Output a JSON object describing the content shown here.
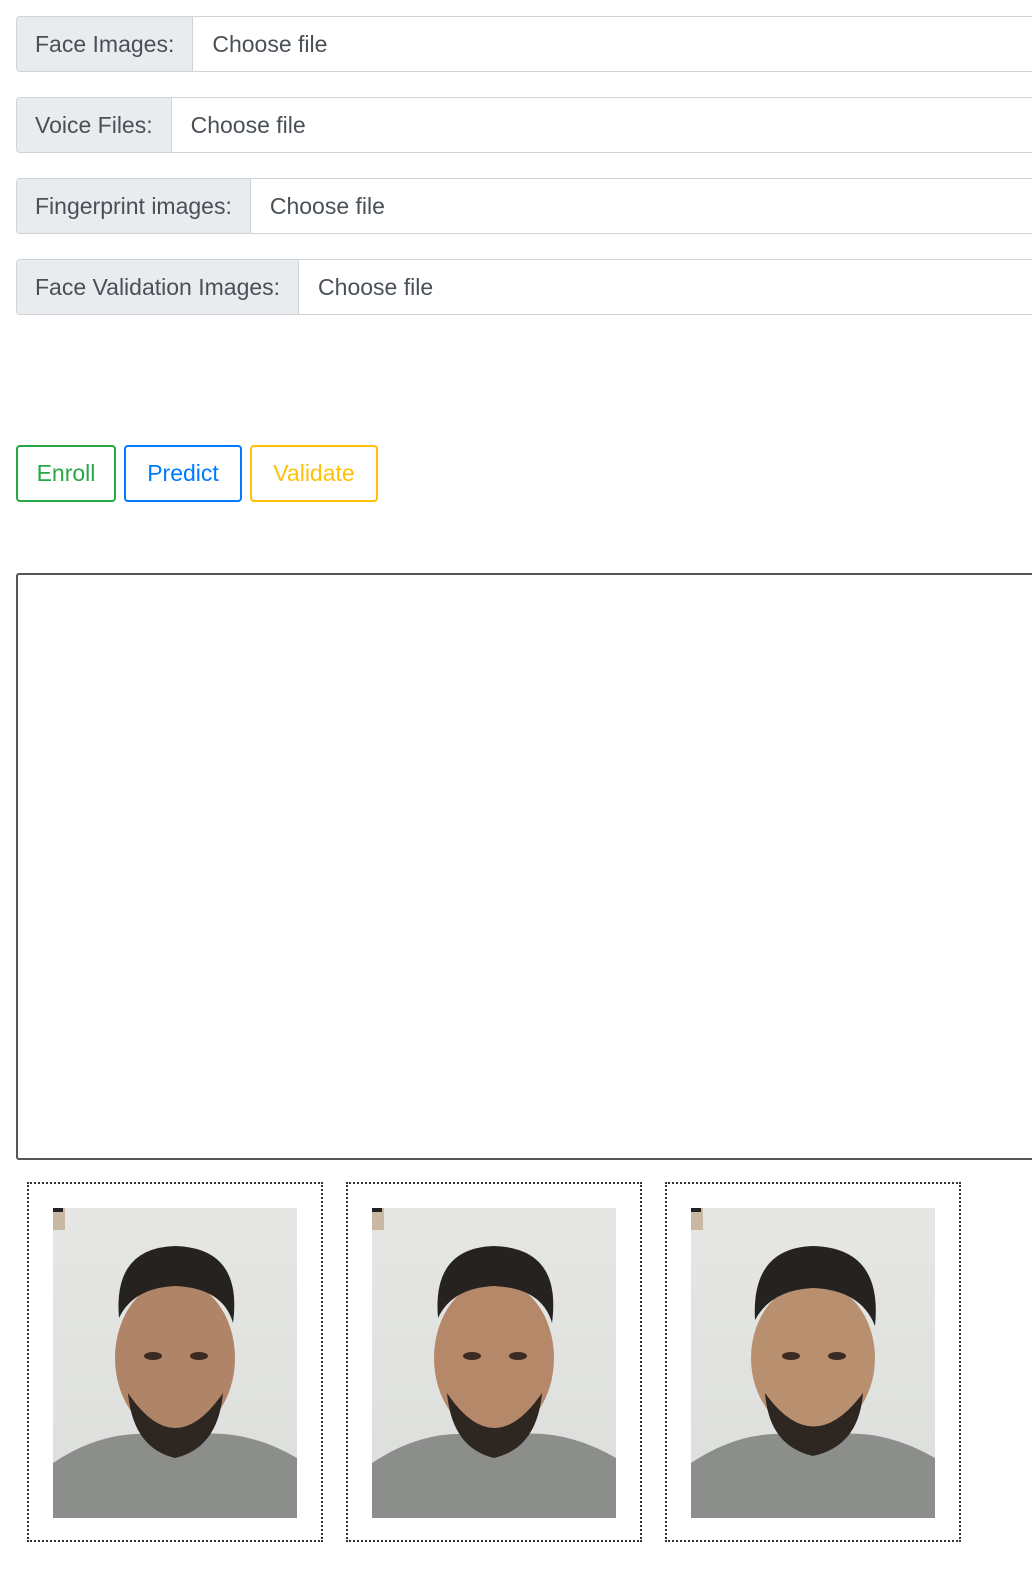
{
  "form": {
    "fields": [
      {
        "label": "Face Images:",
        "value": "Choose file"
      },
      {
        "label": "Voice Files:",
        "value": "Choose file"
      },
      {
        "label": "Fingerprint images:",
        "value": "Choose file"
      },
      {
        "label": "Face Validation Images:",
        "value": "Choose file"
      }
    ]
  },
  "actions": {
    "enroll_label": "Enroll",
    "predict_label": "Predict",
    "validate_label": "Validate",
    "enroll_color": "#28a745",
    "predict_color": "#007bff",
    "validate_color": "#ffc107"
  },
  "gallery": {
    "images": [
      {
        "alt": "face-photo"
      },
      {
        "alt": "face-photo"
      },
      {
        "alt": "face-photo"
      }
    ]
  }
}
